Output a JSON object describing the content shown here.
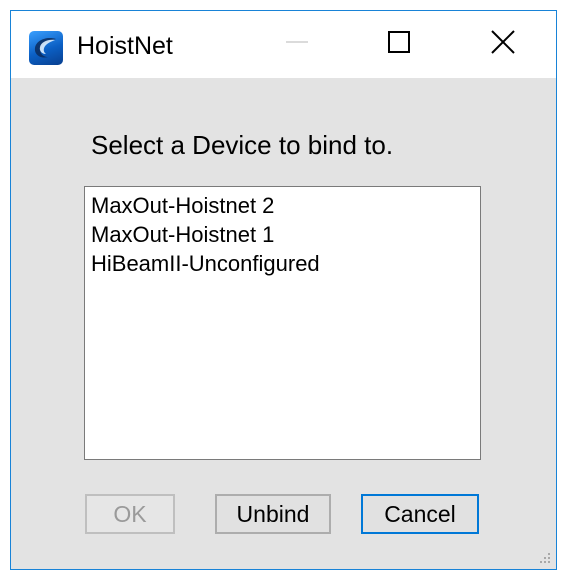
{
  "window": {
    "title": "HoistNet",
    "icon": "hoistnet-logo-icon",
    "controls": [
      "minimize-icon",
      "maximize-icon",
      "close-icon"
    ]
  },
  "dialog": {
    "prompt": "Select a Device to bind to.",
    "devices": [
      "MaxOut-Hoistnet 2",
      "MaxOut-Hoistnet 1",
      "HiBeamII-Unconfigured"
    ],
    "buttons": {
      "ok_label": "OK",
      "unbind_label": "Unbind",
      "cancel_label": "Cancel"
    }
  },
  "colors": {
    "window_border": "#1883d7",
    "client_background": "#e3e3e3",
    "default_button_border": "#0078d7"
  }
}
